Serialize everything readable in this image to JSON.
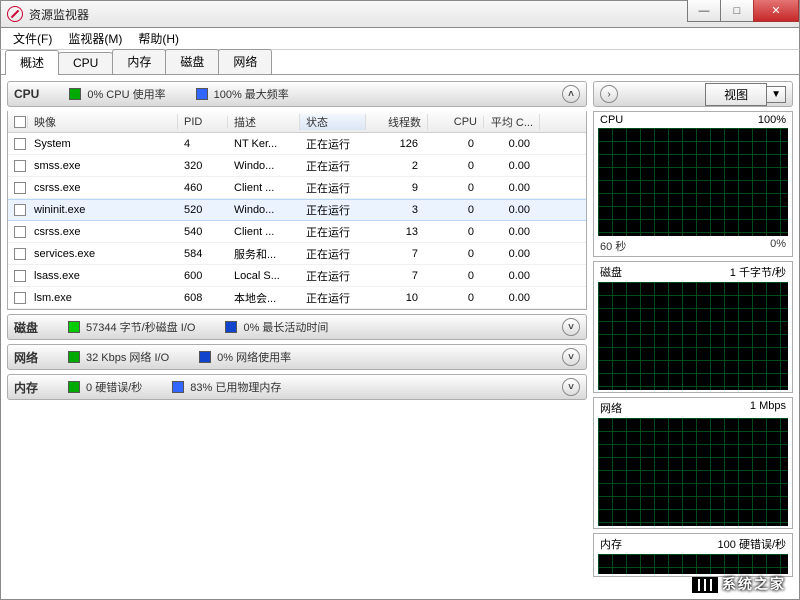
{
  "window": {
    "title": "资源监视器"
  },
  "menu": {
    "file": "文件(F)",
    "monitor": "监视器(M)",
    "help": "帮助(H)"
  },
  "tabs": {
    "overview": "概述",
    "cpu": "CPU",
    "memory": "内存",
    "disk": "磁盘",
    "network": "网络"
  },
  "cpu_section": {
    "title": "CPU",
    "usage": "0% CPU 使用率",
    "freq": "100% 最大频率",
    "columns": {
      "image": "映像",
      "pid": "PID",
      "desc": "描述",
      "status": "状态",
      "threads": "线程数",
      "cpu": "CPU",
      "avg": "平均 C..."
    },
    "rows": [
      {
        "image": "System",
        "pid": "4",
        "desc": "NT Ker...",
        "status": "正在运行",
        "threads": "126",
        "cpu": "0",
        "avg": "0.00"
      },
      {
        "image": "smss.exe",
        "pid": "320",
        "desc": "Windo...",
        "status": "正在运行",
        "threads": "2",
        "cpu": "0",
        "avg": "0.00"
      },
      {
        "image": "csrss.exe",
        "pid": "460",
        "desc": "Client ...",
        "status": "正在运行",
        "threads": "9",
        "cpu": "0",
        "avg": "0.00"
      },
      {
        "image": "wininit.exe",
        "pid": "520",
        "desc": "Windo...",
        "status": "正在运行",
        "threads": "3",
        "cpu": "0",
        "avg": "0.00"
      },
      {
        "image": "csrss.exe",
        "pid": "540",
        "desc": "Client ...",
        "status": "正在运行",
        "threads": "13",
        "cpu": "0",
        "avg": "0.00"
      },
      {
        "image": "services.exe",
        "pid": "584",
        "desc": "服务和...",
        "status": "正在运行",
        "threads": "7",
        "cpu": "0",
        "avg": "0.00"
      },
      {
        "image": "lsass.exe",
        "pid": "600",
        "desc": "Local S...",
        "status": "正在运行",
        "threads": "7",
        "cpu": "0",
        "avg": "0.00"
      },
      {
        "image": "lsm.exe",
        "pid": "608",
        "desc": "本地会...",
        "status": "正在运行",
        "threads": "10",
        "cpu": "0",
        "avg": "0.00"
      }
    ],
    "highlight_index": 3
  },
  "disk_section": {
    "title": "磁盘",
    "io": "57344 字节/秒磁盘 I/O",
    "act": "0% 最长活动时间"
  },
  "network_section": {
    "title": "网络",
    "io": "32 Kbps 网络 I/O",
    "act": "0% 网络使用率"
  },
  "memory_section": {
    "title": "内存",
    "io": "0 硬错误/秒",
    "act": "83% 已用物理内存"
  },
  "right": {
    "view_label": "视图",
    "graphs": {
      "cpu": {
        "title": "CPU",
        "right": "100%",
        "footer_left": "60 秒",
        "footer_right": "0%"
      },
      "disk": {
        "title": "磁盘",
        "right": "1 千字节/秒"
      },
      "net": {
        "title": "网络",
        "right": "1 Mbps"
      },
      "mem": {
        "title": "内存",
        "right": "100 硬错误/秒"
      }
    }
  },
  "watermark": "系统之家"
}
